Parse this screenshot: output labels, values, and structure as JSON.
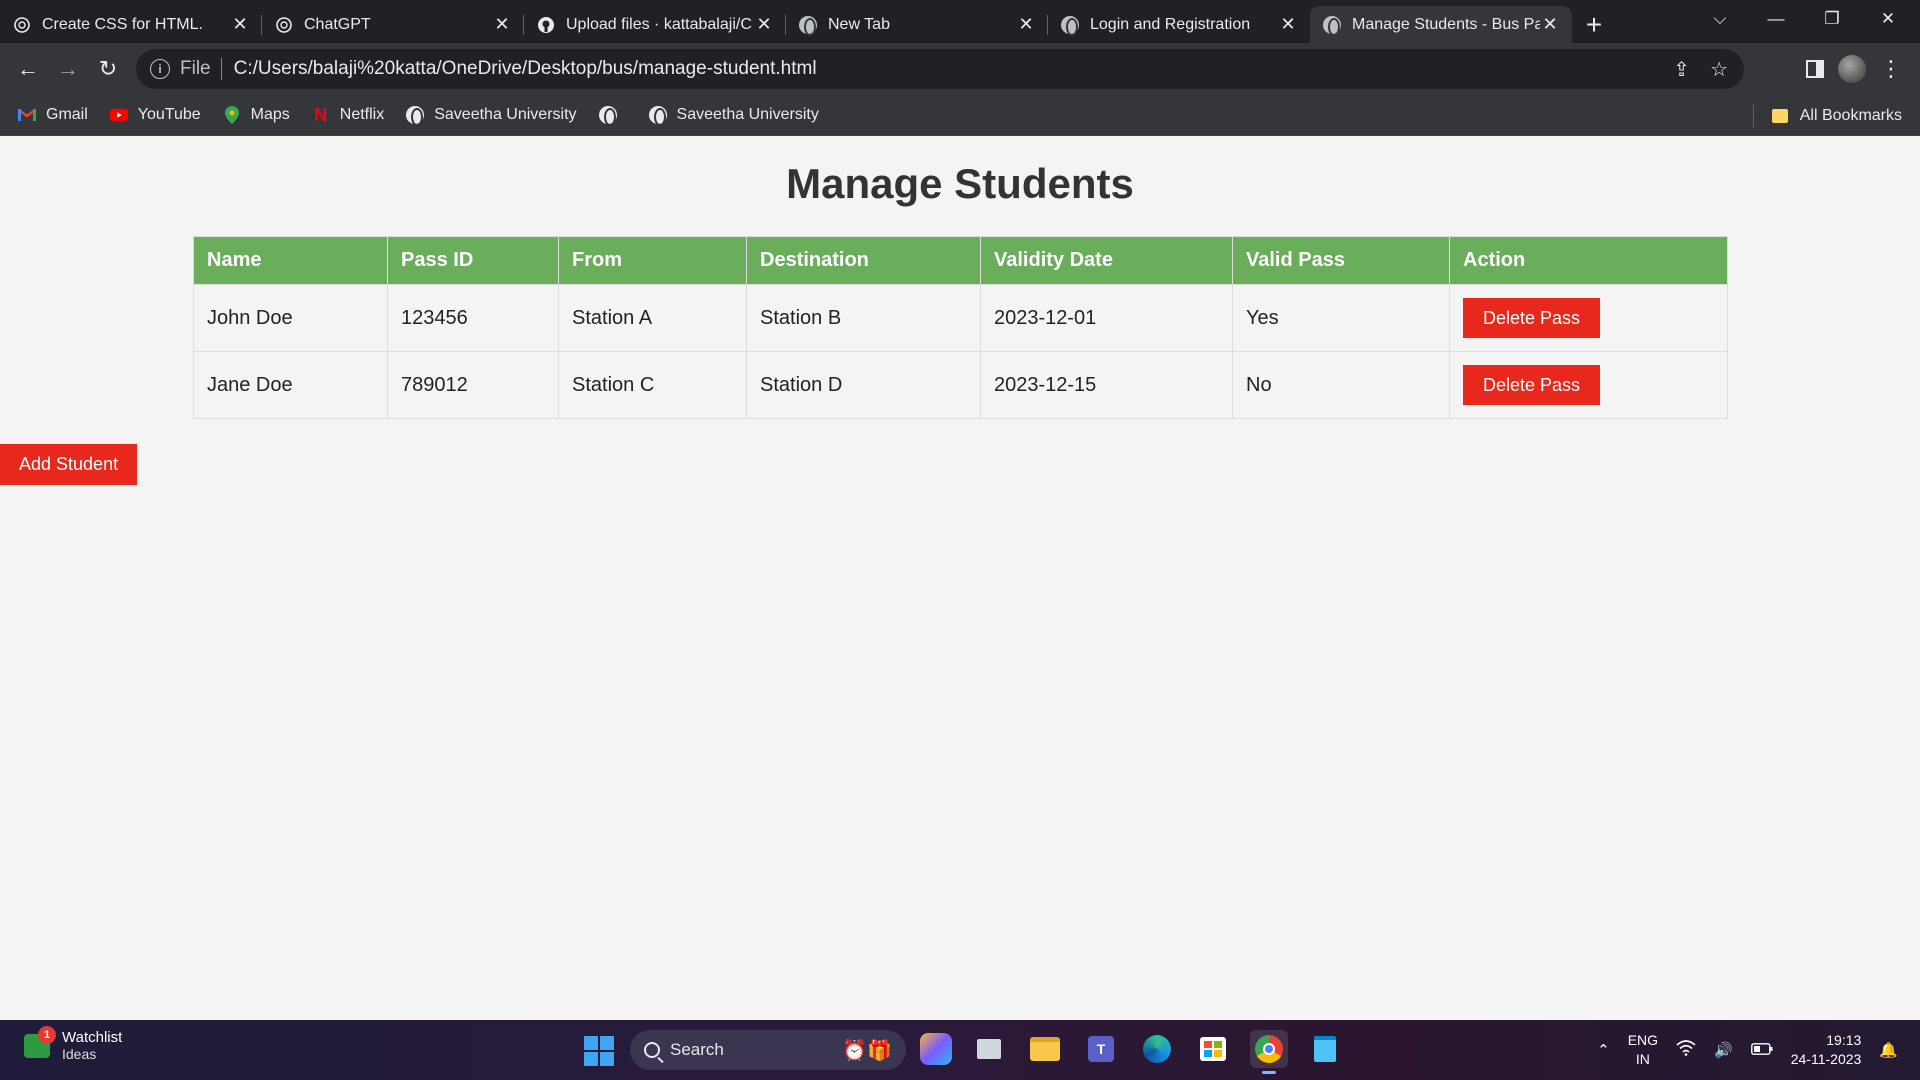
{
  "browser": {
    "tabs": [
      {
        "title": "Create CSS for HTML.",
        "icon": "chatgpt-icon",
        "active": false
      },
      {
        "title": "ChatGPT",
        "icon": "chatgpt-icon",
        "active": false
      },
      {
        "title": "Upload files · kattabalaji/C",
        "icon": "github-icon",
        "active": false
      },
      {
        "title": "New Tab",
        "icon": "globe-icon",
        "active": false
      },
      {
        "title": "Login and Registration",
        "icon": "globe-icon",
        "active": false
      },
      {
        "title": "Manage Students - Bus Pa",
        "icon": "globe-icon",
        "active": true
      }
    ],
    "address": {
      "scheme": "File",
      "url": "C:/Users/balaji%20katta/OneDrive/Desktop/bus/manage-student.html"
    },
    "bookmarks": [
      {
        "label": "Gmail",
        "icon": "gmail-icon"
      },
      {
        "label": "YouTube",
        "icon": "youtube-icon"
      },
      {
        "label": "Maps",
        "icon": "maps-icon"
      },
      {
        "label": "Netflix",
        "icon": "netflix-icon"
      },
      {
        "label": "Saveetha University",
        "icon": "globe-icon"
      },
      {
        "label": "",
        "icon": "globe-icon"
      },
      {
        "label": "Saveetha University",
        "icon": "globe-icon"
      }
    ],
    "all_bookmarks": "All Bookmarks"
  },
  "page": {
    "title": "Manage Students",
    "table": {
      "headers": [
        "Name",
        "Pass ID",
        "From",
        "Destination",
        "Validity Date",
        "Valid Pass",
        "Action"
      ],
      "rows": [
        {
          "name": "John Doe",
          "pass_id": "123456",
          "from": "Station A",
          "destination": "Station B",
          "validity_date": "2023-12-01",
          "valid_pass": "Yes",
          "action": "Delete Pass"
        },
        {
          "name": "Jane Doe",
          "pass_id": "789012",
          "from": "Station C",
          "destination": "Station D",
          "validity_date": "2023-12-15",
          "valid_pass": "No",
          "action": "Delete Pass"
        }
      ]
    },
    "add_button": "Add Student"
  },
  "taskbar": {
    "widget_title": "Watchlist",
    "widget_subtitle": "Ideas",
    "widget_badge": "1",
    "search_label": "Search",
    "lang_top": "ENG",
    "lang_bottom": "IN",
    "time": "19:13",
    "date": "24-11-2023"
  },
  "colors": {
    "table_header": "#6aad5b",
    "danger_button": "#e8281d",
    "page_bg": "#f4f4f4"
  }
}
